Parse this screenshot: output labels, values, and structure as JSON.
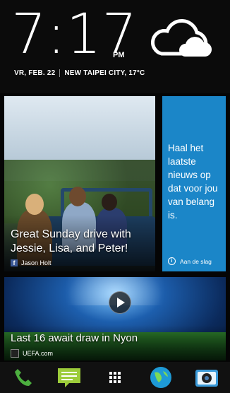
{
  "clock": {
    "time": "7:17",
    "ampm": "PM",
    "date": "VR, FEB. 22",
    "location": "NEW TAIPEI CITY, 17°C",
    "weather_icon": "cloudy-icon"
  },
  "news_tile": {
    "headline": "Great Sunday drive with Jessie, Lisa, and Peter!",
    "source": "Jason Holt",
    "source_icon": "facebook-icon"
  },
  "promo_tile": {
    "text": "Haal het laatste nieuws op dat voor jou van belang is.",
    "cta": "Aan de slag",
    "color": "#1b86c8"
  },
  "video_tile": {
    "headline": "Last 16 await draw in Nyon",
    "source": "UEFA.com",
    "source_icon": "uefa-icon"
  },
  "dock": [
    "phone-icon",
    "messages-icon",
    "apps-icon",
    "browser-icon",
    "camera-icon"
  ]
}
